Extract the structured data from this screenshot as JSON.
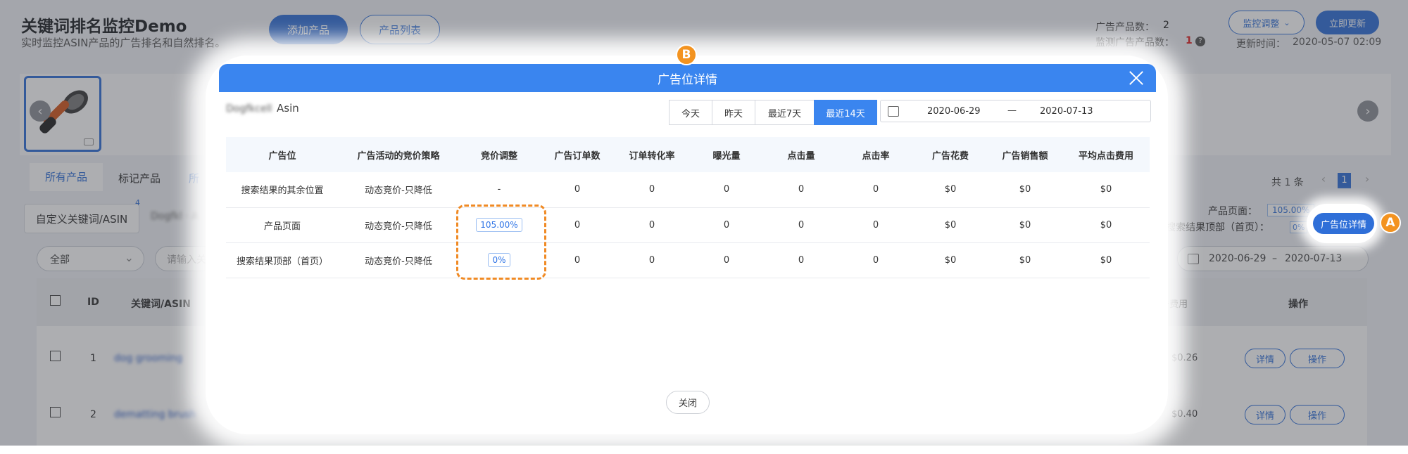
{
  "app": {
    "title": "关键词排名监控Demo",
    "subtitle": "实时监控ASIN产品的广告排名和自然排名。",
    "add_product": "添加产品",
    "product_list": "产品列表"
  },
  "stats": {
    "ad_count_label": "广告产品数：",
    "ad_count": "2",
    "monitor_label": "监测广告产品数：",
    "monitor_count": "1",
    "monitor_adjust": "监控调整",
    "update_now": "立即更新",
    "update_time_label": "更新时间：",
    "update_time": "2020-05-07 02:09"
  },
  "filter_tabs": [
    "所有产品",
    "标记产品",
    "所"
  ],
  "custom_keyword_btn": "自定义关键词/ASIN",
  "custom_keyword_badge": "4",
  "blurred_chip": "Dogfkl · A",
  "select_all": "全部",
  "search_placeholder": "请输入关",
  "pagination": {
    "total": "共 1 条",
    "page": "1"
  },
  "right_panel": {
    "product_page_label": "产品页面：",
    "product_page_val": "105.00%",
    "search_top_label": "搜索结果顶部（首页）：",
    "search_top_val": "0%",
    "ad_detail_btn": "广告位详情"
  },
  "bg_date": {
    "start": "2020-06-29",
    "sep": "–",
    "end": "2020-07-13"
  },
  "bg_table": {
    "headers": {
      "id": "ID",
      "keyword": "关键词/ASIN",
      "cpc": "击费用",
      "ops": "操作"
    },
    "rows": [
      {
        "id": "1",
        "keyword": "dog grooming",
        "cpc": "$0.26",
        "detail": "详情",
        "op": "操作"
      },
      {
        "id": "2",
        "keyword": "dematting brush",
        "cpc": "$0.40",
        "detail": "详情",
        "op": "操作"
      }
    ]
  },
  "badges": {
    "a": "A",
    "b": "B"
  },
  "modal": {
    "title": "广告位详情",
    "asin_blur": "Dogfkcell",
    "asin_label": "Asin",
    "seg": [
      "今天",
      "昨天",
      "最近7天",
      "最近14天"
    ],
    "date_start": "2020-06-29",
    "date_sep": "—",
    "date_end": "2020-07-13",
    "headers": [
      "广告位",
      "广告活动的竞价策略",
      "竞价调整",
      "广告订单数",
      "订单转化率",
      "曝光量",
      "点击量",
      "点击率",
      "广告花费",
      "广告销售额",
      "平均点击费用"
    ],
    "rows": [
      [
        "搜索结果的其余位置",
        "动态竞价-只降低",
        "-",
        "0",
        "0",
        "0",
        "0",
        "0",
        "$0",
        "$0",
        "$0"
      ],
      [
        "产品页面",
        "动态竞价-只降低",
        "105.00%",
        "0",
        "0",
        "0",
        "0",
        "0",
        "$0",
        "$0",
        "$0"
      ],
      [
        "搜索结果顶部（首页）",
        "动态竞价-只降低",
        "0%",
        "0",
        "0",
        "0",
        "0",
        "0",
        "$0",
        "$0",
        "$0"
      ]
    ],
    "close_label": "关闭"
  },
  "colors": {
    "accent": "#3a85ef",
    "highlight": "#f08a24",
    "danger": "#e02020"
  }
}
